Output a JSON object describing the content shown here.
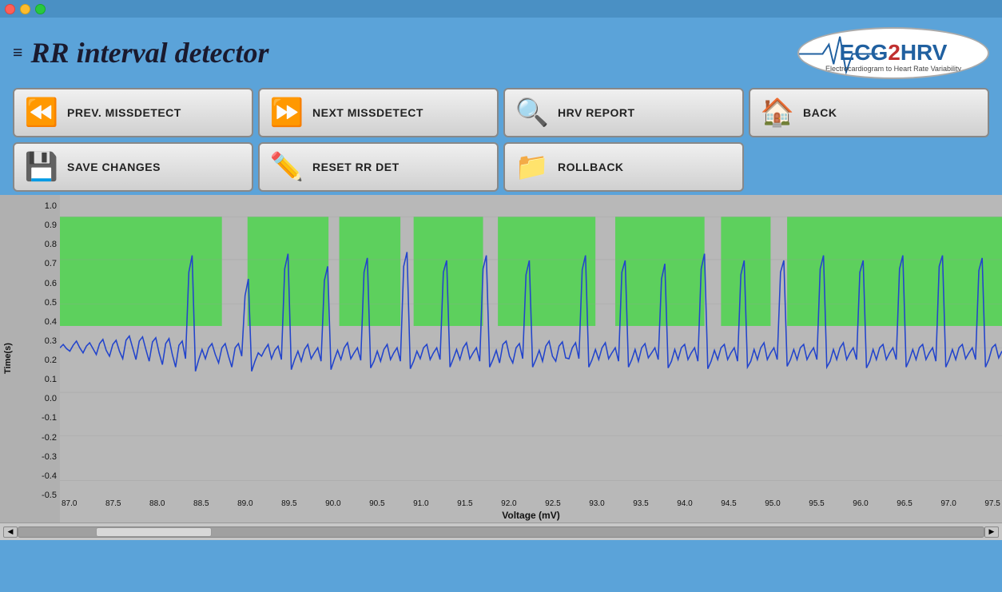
{
  "titleBar": {
    "buttons": [
      "close",
      "minimize",
      "maximize"
    ]
  },
  "header": {
    "appTitle": "RR interval detector",
    "appTitleIcon": "≡",
    "logo": {
      "ecgText": "ECG",
      "numText": "2",
      "hrvText": "HRV",
      "subText": "Electrocardiogram to Heart Rate Variability"
    }
  },
  "buttons": {
    "prevMissdetect": "PREV. MISSDETECT",
    "nextMissdetect": "NEXT MISSDETECT",
    "hrvReport": "HRV REPORT",
    "back": "BACK",
    "saveChanges": "SAVE CHANGES",
    "resetRrDet": "RESET RR DET",
    "rollback": "ROLLBACK"
  },
  "chart": {
    "yAxisLabel": "Time(s)",
    "xAxisLabel": "Voltage (mV)",
    "yTicks": [
      "1.0",
      "0.9",
      "0.8",
      "0.7",
      "0.6",
      "0.5",
      "0.4",
      "0.3",
      "0.2",
      "0.1",
      "0.0",
      "-0.1",
      "-0.2",
      "-0.3",
      "-0.4",
      "-0.5"
    ],
    "xTicks": [
      "87.0",
      "87.5",
      "88.0",
      "88.5",
      "89.0",
      "89.5",
      "90.0",
      "90.5",
      "91.0",
      "91.5",
      "92.0",
      "92.5",
      "93.0",
      "93.5",
      "94.0",
      "94.5",
      "95.0",
      "95.5",
      "96.0",
      "96.5",
      "97.0",
      "97.5"
    ]
  },
  "colors": {
    "background": "#5ba3d9",
    "chartBg": "#b8b8b8",
    "greenBand": "#4cd44c",
    "ecgLine": "#2244cc",
    "buttonBg": "#e8e8e8"
  }
}
